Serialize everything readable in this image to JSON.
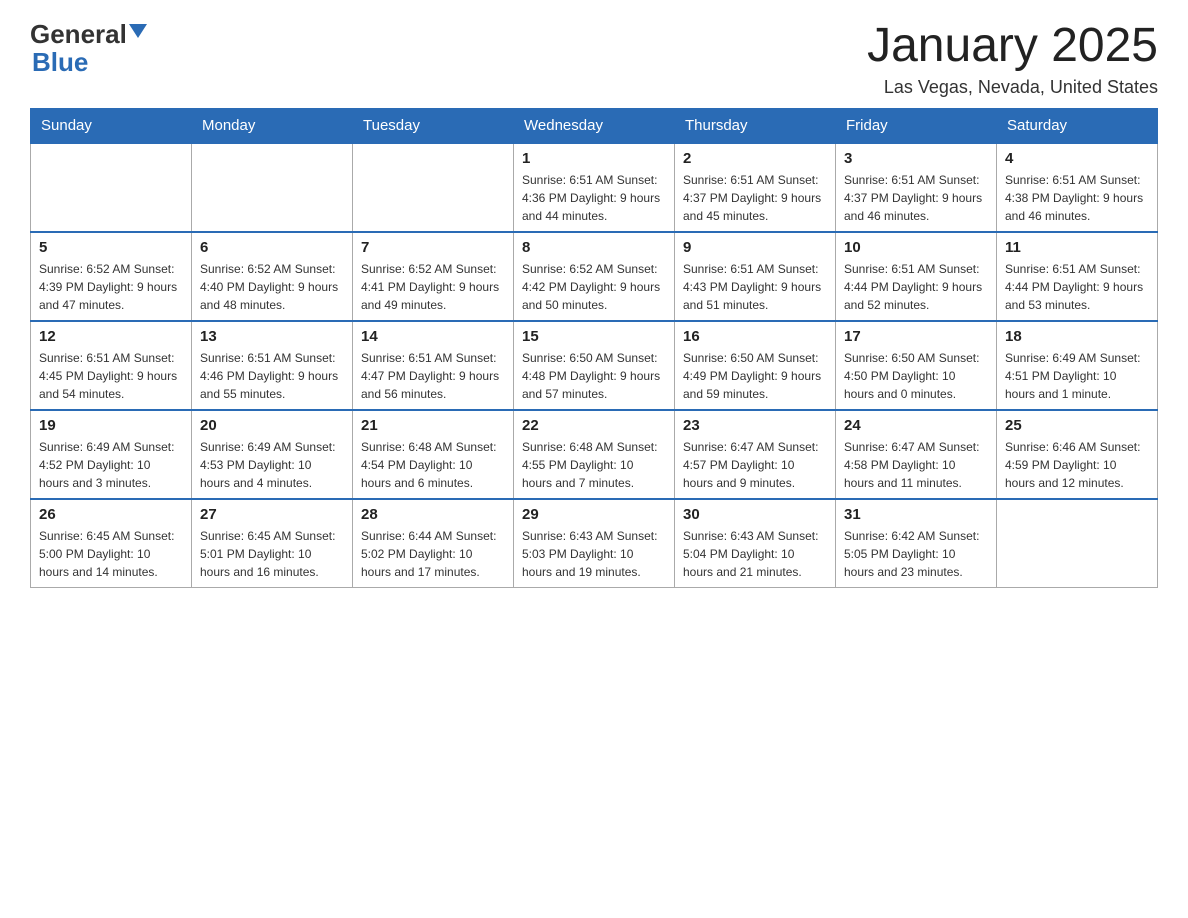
{
  "logo": {
    "text_general": "General",
    "text_blue": "Blue"
  },
  "title": "January 2025",
  "location": "Las Vegas, Nevada, United States",
  "days_of_week": [
    "Sunday",
    "Monday",
    "Tuesday",
    "Wednesday",
    "Thursday",
    "Friday",
    "Saturday"
  ],
  "weeks": [
    [
      {
        "day": "",
        "info": ""
      },
      {
        "day": "",
        "info": ""
      },
      {
        "day": "",
        "info": ""
      },
      {
        "day": "1",
        "info": "Sunrise: 6:51 AM\nSunset: 4:36 PM\nDaylight: 9 hours and 44 minutes."
      },
      {
        "day": "2",
        "info": "Sunrise: 6:51 AM\nSunset: 4:37 PM\nDaylight: 9 hours and 45 minutes."
      },
      {
        "day": "3",
        "info": "Sunrise: 6:51 AM\nSunset: 4:37 PM\nDaylight: 9 hours and 46 minutes."
      },
      {
        "day": "4",
        "info": "Sunrise: 6:51 AM\nSunset: 4:38 PM\nDaylight: 9 hours and 46 minutes."
      }
    ],
    [
      {
        "day": "5",
        "info": "Sunrise: 6:52 AM\nSunset: 4:39 PM\nDaylight: 9 hours and 47 minutes."
      },
      {
        "day": "6",
        "info": "Sunrise: 6:52 AM\nSunset: 4:40 PM\nDaylight: 9 hours and 48 minutes."
      },
      {
        "day": "7",
        "info": "Sunrise: 6:52 AM\nSunset: 4:41 PM\nDaylight: 9 hours and 49 minutes."
      },
      {
        "day": "8",
        "info": "Sunrise: 6:52 AM\nSunset: 4:42 PM\nDaylight: 9 hours and 50 minutes."
      },
      {
        "day": "9",
        "info": "Sunrise: 6:51 AM\nSunset: 4:43 PM\nDaylight: 9 hours and 51 minutes."
      },
      {
        "day": "10",
        "info": "Sunrise: 6:51 AM\nSunset: 4:44 PM\nDaylight: 9 hours and 52 minutes."
      },
      {
        "day": "11",
        "info": "Sunrise: 6:51 AM\nSunset: 4:44 PM\nDaylight: 9 hours and 53 minutes."
      }
    ],
    [
      {
        "day": "12",
        "info": "Sunrise: 6:51 AM\nSunset: 4:45 PM\nDaylight: 9 hours and 54 minutes."
      },
      {
        "day": "13",
        "info": "Sunrise: 6:51 AM\nSunset: 4:46 PM\nDaylight: 9 hours and 55 minutes."
      },
      {
        "day": "14",
        "info": "Sunrise: 6:51 AM\nSunset: 4:47 PM\nDaylight: 9 hours and 56 minutes."
      },
      {
        "day": "15",
        "info": "Sunrise: 6:50 AM\nSunset: 4:48 PM\nDaylight: 9 hours and 57 minutes."
      },
      {
        "day": "16",
        "info": "Sunrise: 6:50 AM\nSunset: 4:49 PM\nDaylight: 9 hours and 59 minutes."
      },
      {
        "day": "17",
        "info": "Sunrise: 6:50 AM\nSunset: 4:50 PM\nDaylight: 10 hours and 0 minutes."
      },
      {
        "day": "18",
        "info": "Sunrise: 6:49 AM\nSunset: 4:51 PM\nDaylight: 10 hours and 1 minute."
      }
    ],
    [
      {
        "day": "19",
        "info": "Sunrise: 6:49 AM\nSunset: 4:52 PM\nDaylight: 10 hours and 3 minutes."
      },
      {
        "day": "20",
        "info": "Sunrise: 6:49 AM\nSunset: 4:53 PM\nDaylight: 10 hours and 4 minutes."
      },
      {
        "day": "21",
        "info": "Sunrise: 6:48 AM\nSunset: 4:54 PM\nDaylight: 10 hours and 6 minutes."
      },
      {
        "day": "22",
        "info": "Sunrise: 6:48 AM\nSunset: 4:55 PM\nDaylight: 10 hours and 7 minutes."
      },
      {
        "day": "23",
        "info": "Sunrise: 6:47 AM\nSunset: 4:57 PM\nDaylight: 10 hours and 9 minutes."
      },
      {
        "day": "24",
        "info": "Sunrise: 6:47 AM\nSunset: 4:58 PM\nDaylight: 10 hours and 11 minutes."
      },
      {
        "day": "25",
        "info": "Sunrise: 6:46 AM\nSunset: 4:59 PM\nDaylight: 10 hours and 12 minutes."
      }
    ],
    [
      {
        "day": "26",
        "info": "Sunrise: 6:45 AM\nSunset: 5:00 PM\nDaylight: 10 hours and 14 minutes."
      },
      {
        "day": "27",
        "info": "Sunrise: 6:45 AM\nSunset: 5:01 PM\nDaylight: 10 hours and 16 minutes."
      },
      {
        "day": "28",
        "info": "Sunrise: 6:44 AM\nSunset: 5:02 PM\nDaylight: 10 hours and 17 minutes."
      },
      {
        "day": "29",
        "info": "Sunrise: 6:43 AM\nSunset: 5:03 PM\nDaylight: 10 hours and 19 minutes."
      },
      {
        "day": "30",
        "info": "Sunrise: 6:43 AM\nSunset: 5:04 PM\nDaylight: 10 hours and 21 minutes."
      },
      {
        "day": "31",
        "info": "Sunrise: 6:42 AM\nSunset: 5:05 PM\nDaylight: 10 hours and 23 minutes."
      },
      {
        "day": "",
        "info": ""
      }
    ]
  ]
}
